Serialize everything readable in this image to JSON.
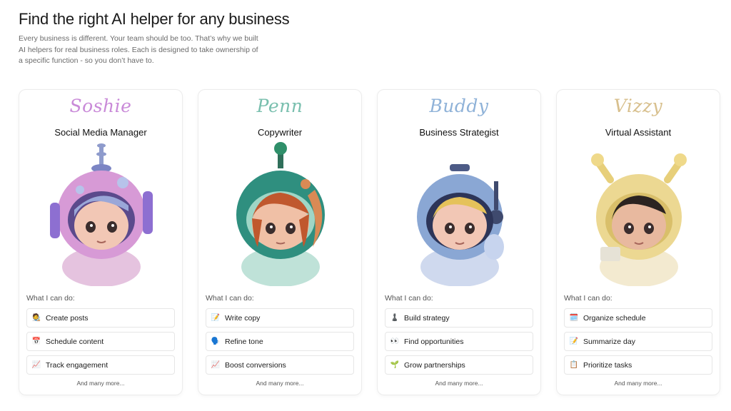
{
  "header": {
    "title": "Find the right AI helper for any business",
    "subtitle": "Every business is different. Your team should be too. That’s why we built AI helpers for real business roles. Each is designed to take ownership of a specific function - so you don’t have to."
  },
  "cando_label": "What I can do:",
  "more_label": "And many more...",
  "agents": [
    {
      "name": "Soshie",
      "role": "Social Media Manager",
      "accent": "#c98ad8",
      "helmet": "#d79ad6",
      "capabilities": [
        {
          "emoji": "🧑‍🎨",
          "label": "Create posts"
        },
        {
          "emoji": "📅",
          "label": "Schedule content"
        },
        {
          "emoji": "📈",
          "label": "Track engagement"
        }
      ]
    },
    {
      "name": "Penn",
      "role": "Copywriter",
      "accent": "#79bfae",
      "helmet": "#2f8f7f",
      "capabilities": [
        {
          "emoji": "📝",
          "label": "Write copy"
        },
        {
          "emoji": "🗣️",
          "label": "Refine tone"
        },
        {
          "emoji": "📈",
          "label": "Boost conversions"
        }
      ]
    },
    {
      "name": "Buddy",
      "role": "Business Strategist",
      "accent": "#8fb2d8",
      "helmet": "#8aa7d4",
      "capabilities": [
        {
          "emoji": "♟️",
          "label": "Build strategy"
        },
        {
          "emoji": "👀",
          "label": "Find opportunities"
        },
        {
          "emoji": "🌱",
          "label": "Grow partnerships"
        }
      ]
    },
    {
      "name": "Vizzy",
      "role": "Virtual Assistant",
      "accent": "#d8c08e",
      "helmet": "#ecd892",
      "capabilities": [
        {
          "emoji": "🗓️",
          "label": "Organize schedule"
        },
        {
          "emoji": "📝",
          "label": "Summarize day"
        },
        {
          "emoji": "📋",
          "label": "Prioritize tasks"
        }
      ]
    }
  ]
}
